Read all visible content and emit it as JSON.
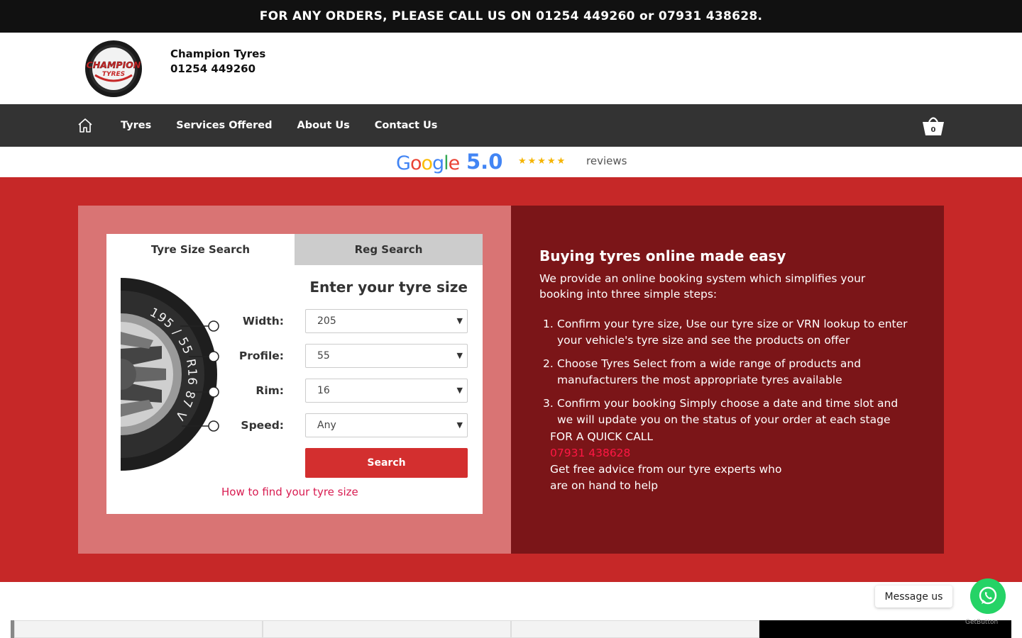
{
  "topbar": {
    "text": "FOR ANY ORDERS, PLEASE CALL US ON 01254 449260 or 07931 438628."
  },
  "header": {
    "logo_text_top": "CHAMPION",
    "logo_text_bottom": "TYRES",
    "brand_name": "Champion Tyres",
    "brand_phone": "01254 449260"
  },
  "nav": {
    "items": [
      {
        "label": "Tyres"
      },
      {
        "label": "Services Offered"
      },
      {
        "label": "About Us"
      },
      {
        "label": "Contact Us"
      }
    ],
    "cart_count": "0"
  },
  "reviews": {
    "provider": "Google",
    "rating": "5.0",
    "stars": "★★★★★",
    "label": "reviews"
  },
  "search_card": {
    "tabs": [
      {
        "label": "Tyre Size Search",
        "active": true
      },
      {
        "label": "Reg Search",
        "active": false
      }
    ],
    "title": "Enter your tyre size",
    "tyre_markings": "195 / 55 R16 87 V",
    "fields": [
      {
        "label": "Width:",
        "value": "205"
      },
      {
        "label": "Profile:",
        "value": "55"
      },
      {
        "label": "Rim:",
        "value": "16"
      },
      {
        "label": "Speed:",
        "value": "Any"
      }
    ],
    "search_label": "Search",
    "howto_glyph": "",
    "howto_link": "How to find your tyre size"
  },
  "info": {
    "title": "Buying tyres online made easy",
    "intro": "We provide an online booking system which simplifies your booking into three simple steps:",
    "steps": [
      {
        "num": "1.",
        "text": "Confirm your tyre size, Use our tyre size or VRN lookup to enter your vehicle's tyre size and see the products on offer"
      },
      {
        "num": "2.",
        "text": "Choose Tyres Select from a wide range of products and manufacturers the most appropriate tyres available"
      },
      {
        "num": "3.",
        "text": "Confirm your booking Simply choose a date and time slot and we will update you on the status of your order at each stage"
      }
    ],
    "quick_glyph": "",
    "quick_call_label": "FOR A QUICK CALL",
    "quick_call_phone": "07931 438628",
    "quick_call_text_1": "Get free advice from our tyre experts who",
    "quick_call_text_2": "are on hand to help"
  },
  "widget": {
    "message_label": "Message us",
    "powered_by": "GetButton"
  },
  "colors": {
    "hero_red": "#c62828",
    "panel_pink": "#d97474",
    "panel_dark": "#7b1518",
    "button_red": "#d32f2f",
    "link_pink": "#d81b50",
    "whatsapp_green": "#25d366"
  }
}
